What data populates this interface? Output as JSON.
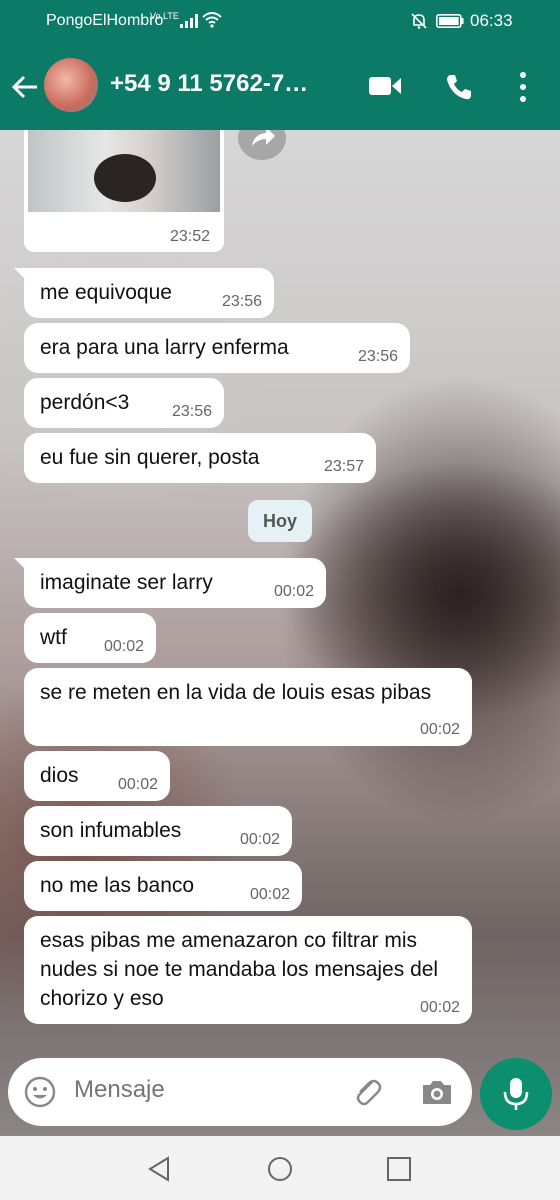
{
  "status_bar": {
    "carrier": "PongoElHombro",
    "volte": "Vo LTE",
    "time": "06:33"
  },
  "header": {
    "contact": "+54 9 11 5762-7…"
  },
  "messages": [
    {
      "type": "image",
      "time": "23:52"
    },
    {
      "text": "me equivoque",
      "time": "23:56"
    },
    {
      "text": "era para una larry enferma",
      "time": "23:56"
    },
    {
      "text": "perdón<3",
      "time": "23:56"
    },
    {
      "text": "eu fue sin querer, posta",
      "time": "23:57"
    },
    {
      "text": "imaginate ser larry",
      "time": "00:02"
    },
    {
      "text": "wtf",
      "time": "00:02"
    },
    {
      "text": "se re meten en la vida de louis esas pibas",
      "time": "00:02"
    },
    {
      "text": "dios",
      "time": "00:02"
    },
    {
      "text": "son infumables",
      "time": "00:02"
    },
    {
      "text": "no me las banco",
      "time": "00:02"
    },
    {
      "text": "esas pibas me amenazaron co  filtrar mis nudes si noe te mandaba los mensajes del chorizo y eso",
      "time": "00:02"
    }
  ],
  "day_separator": "Hoy",
  "input": {
    "placeholder": "Mensaje"
  },
  "colors": {
    "header_bg": "#0b7a67",
    "mic_bg": "#0b8f6e",
    "bubble_bg": "#ffffff"
  }
}
